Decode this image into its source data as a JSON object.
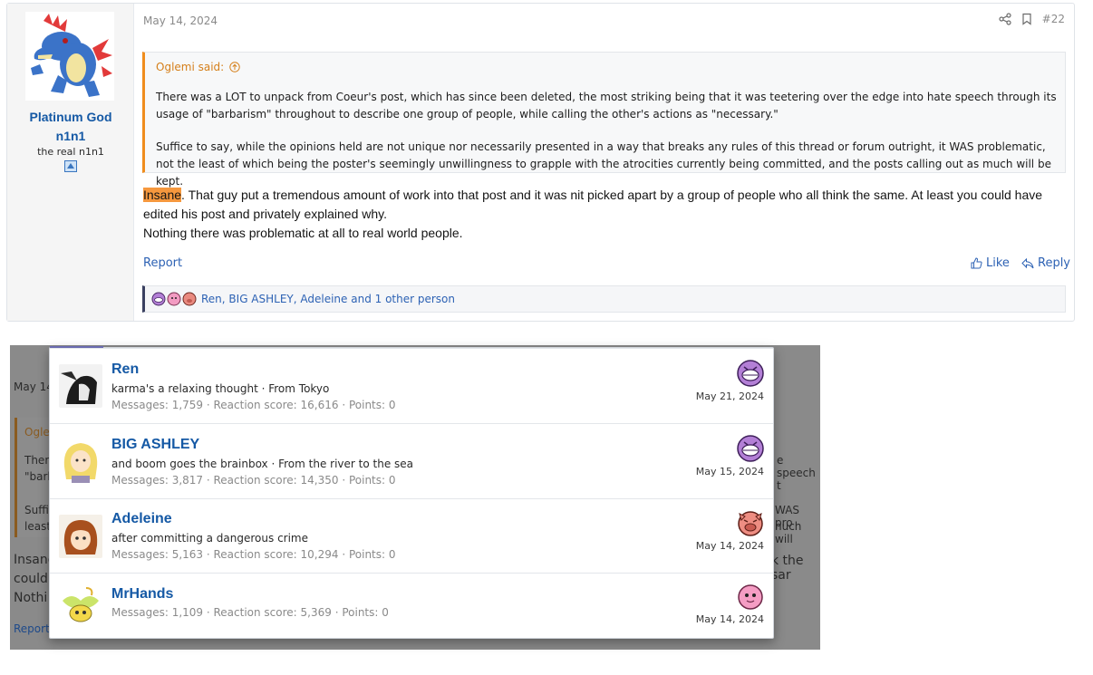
{
  "post": {
    "user": {
      "name": "Platinum God n1n1",
      "title": "the real n1n1"
    },
    "date": "May 14, 2024",
    "post_number": "#22",
    "quote": {
      "author": "Oglemi said:",
      "paragraph1": "There was a LOT to unpack from Coeur's post, which has since been deleted, the most striking being that it was teetering over the edge into hate speech through its usage of \"barbarism\" throughout to describe one group of people, while calling the other's actions as \"necessary.\"",
      "paragraph2": "Suffice to say, while the opinions held are not unique nor necessarily presented in a way that breaks any rules of this thread or forum outright, it WAS problematic, not the least of which being the poster's seemingly unwillingness to grapple with the atrocities currently being committed, and the posts calling out as much will be kept."
    },
    "message": {
      "highlight": "Insane",
      "line1_rest": ". That guy put a tremendous amount of work into that post and it was nit picked apart by a group of people who all think the same. At least you could have edited his post and privately explained why.",
      "line2": "Nothing there was problematic at all to real world people."
    },
    "footer": {
      "report": "Report",
      "like": "Like",
      "reply": "Reply"
    },
    "reactions_summary": "Ren, BIG ASHLEY, Adeleine and 1 other person"
  },
  "background": {
    "date": "May 14",
    "quote_author": "Ogle",
    "quote_l1": "Ther",
    "quote_l2": "\"barl",
    "quote_l3": "Suffi",
    "quote_l4": "least",
    "msg1": "Insane",
    "msg2": "could",
    "msg3": "Nothi",
    "report": "Report",
    "right1": "e speech t",
    "right2": "WAS pro",
    "right3": "nuch will",
    "right4": "k the sar"
  },
  "reactors": [
    {
      "name": "Ren",
      "line": "karma's a relaxing thought · From Tokyo",
      "stats": "Messages: 1,759 · Reaction score: 16,616 · Points: 0",
      "date": "May 21, 2024",
      "reaction": "purple-face"
    },
    {
      "name": "BIG ASHLEY",
      "line": "and boom goes the brainbox · From the river to the sea",
      "stats": "Messages: 3,817 · Reaction score: 14,350 · Points: 0",
      "date": "May 15, 2024",
      "reaction": "purple-face"
    },
    {
      "name": "Adeleine",
      "line": "after committing a dangerous crime",
      "stats": "Messages: 5,163 · Reaction score: 10,294 · Points: 0",
      "date": "May 14, 2024",
      "reaction": "angry-pig-face"
    },
    {
      "name": "MrHands",
      "line": "",
      "stats": "Messages: 1,109 · Reaction score: 5,369 · Points: 0",
      "date": "May 14, 2024",
      "reaction": "pink-blob-face"
    }
  ],
  "colors": {
    "link": "#2d62b4",
    "username": "#1559a5",
    "quote_border": "#f08d1d",
    "highlight": "#f6983e"
  }
}
